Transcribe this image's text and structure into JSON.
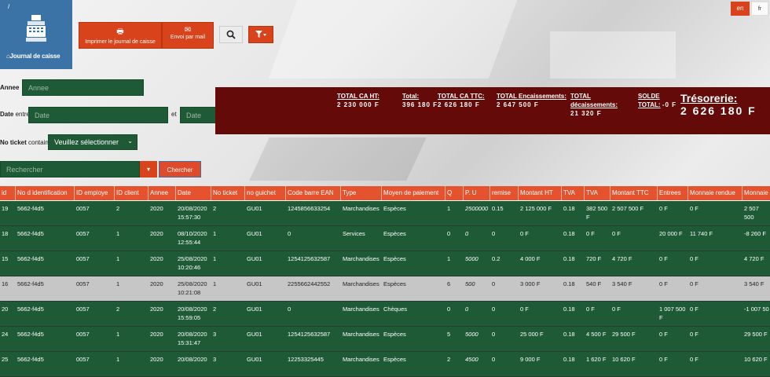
{
  "app": {
    "title": "Journal de caisse",
    "breadcrumb": "/"
  },
  "toolbar": {
    "print_label": "Imprimer le journal de caisse",
    "mail_label": "Envoi par mail",
    "search_icon": "search-icon",
    "filter_icon": "filter-icon"
  },
  "lang": {
    "en": "en",
    "fr": "fr"
  },
  "filters": {
    "annee_label": "Annee",
    "annee_placeholder": "Annee",
    "date_label": "Date",
    "date_sub": "entre",
    "date_placeholder": "Date",
    "et_label": "et",
    "ticket_label": "No ticket",
    "ticket_sub": "contains",
    "ticket_select": "Veuillez sélectionner",
    "search_placeholder": "Rechercher",
    "search_button": "Chercher"
  },
  "totals": {
    "ca_ht_label": "TOTAL CA HT:",
    "ca_ht_value": "2 230 000 F",
    "total_label": "Total:",
    "total_value": "396 180 F",
    "ca_ttc_label": "TOTAL CA TTC:",
    "ca_ttc_value": "2 626 180 F",
    "enc_label": "TOTAL Encaissements:",
    "enc_value": "2 647 500 F",
    "dec_label": "TOTAL décaissements:",
    "dec_value": "21 320 F",
    "solde_label": "SOLDE TOTAL:",
    "solde_value": "-0 F",
    "tres_label": "Trésorerie:",
    "tres_value": "2 626 180 F"
  },
  "table": {
    "headers": [
      "id",
      "No d identification",
      "ID employe",
      "ID client",
      "Annee",
      "Date",
      "No ticket",
      "no guichet",
      "Code barre EAN",
      "Type",
      "Moyen de paiement",
      "Q",
      "P. U",
      "remise",
      "Montant HT",
      "TVA",
      "TVA",
      "Montant TTC",
      "Entrees",
      "Monnaie rendue",
      "Monnaie a"
    ],
    "rows": [
      [
        "19",
        "5662-f4d5",
        "0057",
        "2",
        "2020",
        "20/08/2020 15:57:30",
        "2",
        "GU01",
        "1245856633254",
        "Marchandises",
        "Espèces",
        "1",
        "2500000",
        "0.15",
        "2 125 000 F",
        "0.18",
        "382 500 F",
        "2 507 500 F",
        "0 F",
        "0 F",
        "2 507 500"
      ],
      [
        "18",
        "5662-f4d5",
        "0057",
        "1",
        "2020",
        "08/10/2020 12:55:44",
        "1",
        "GU01",
        "0",
        "Services",
        "Espèces",
        "0",
        "0",
        "0",
        "0 F",
        "0.18",
        "0 F",
        "0 F",
        "20 000 F",
        "11 740 F",
        "-8 260 F"
      ],
      [
        "15",
        "5662-f4d5",
        "0057",
        "1",
        "2020",
        "25/08/2020 10:20:46",
        "1",
        "GU01",
        "1254125632587",
        "Marchandises",
        "Espèces",
        "1",
        "5000",
        "0.2",
        "4 000 F",
        "0.18",
        "720 F",
        "4 720 F",
        "0 F",
        "0 F",
        "4 720 F"
      ],
      [
        "16",
        "5662-f4d5",
        "0057",
        "1",
        "2020",
        "25/08/2020 10:21:08",
        "1",
        "GU01",
        "2255662442552",
        "Marchandises",
        "Espèces",
        "6",
        "500",
        "0",
        "3 000 F",
        "0.18",
        "540 F",
        "3 540 F",
        "0 F",
        "0 F",
        "3 540 F"
      ],
      [
        "20",
        "5662-f4d5",
        "0057",
        "2",
        "2020",
        "20/08/2020 15:59:05",
        "2",
        "GU01",
        "0",
        "Marchandises",
        "Chèques",
        "0",
        "0",
        "0",
        "0 F",
        "0.18",
        "0 F",
        "0 F",
        "1 007 500 F",
        "0 F",
        "-1 007 50"
      ],
      [
        "24",
        "5662-f4d5",
        "0057",
        "1",
        "2020",
        "20/08/2020 15:31:47",
        "3",
        "GU01",
        "1254125632587",
        "Marchandises",
        "Espèces",
        "5",
        "5000",
        "0",
        "25 000 F",
        "0.18",
        "4 500 F",
        "29 500 F",
        "0 F",
        "0 F",
        "29 500 F"
      ],
      [
        "25",
        "5662-f4d5",
        "0057",
        "1",
        "2020",
        "20/08/2020",
        "3",
        "GU01",
        "12253325445",
        "Marchandises",
        "Espèces",
        "2",
        "4500",
        "0",
        "9 000 F",
        "0.18",
        "1 620 F",
        "10 620 F",
        "0 F",
        "0 F",
        "10 620 F"
      ]
    ]
  },
  "colors": {
    "accent": "#d9431c",
    "green": "#1f5a36",
    "banner": "#640b09",
    "brand": "#3b73a6"
  }
}
